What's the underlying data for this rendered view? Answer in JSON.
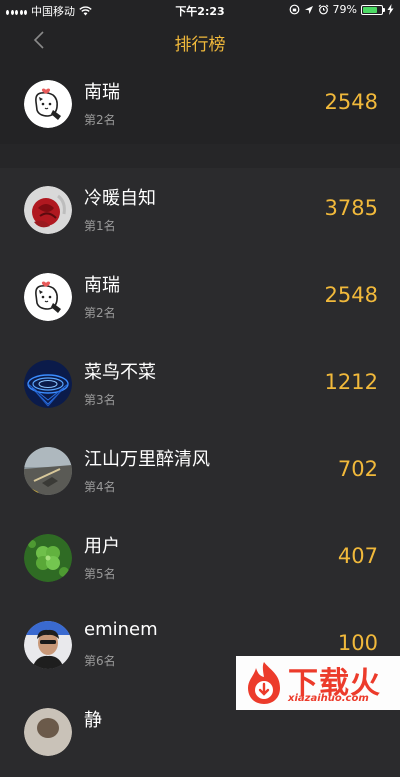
{
  "status": {
    "carrier": "中国移动",
    "time": "下午2:23",
    "battery": "79%",
    "battery_level": 0.79
  },
  "nav": {
    "title": "排行榜"
  },
  "my_rank": {
    "name": "南瑞",
    "rank_label": "第2名",
    "score": "2548"
  },
  "ranking": [
    {
      "name": "冷暖自知",
      "rank_label": "第1名",
      "score": "3785"
    },
    {
      "name": "南瑞",
      "rank_label": "第2名",
      "score": "2548"
    },
    {
      "name": "菜鸟不菜",
      "rank_label": "第3名",
      "score": "1212"
    },
    {
      "name": "江山万里醉清风",
      "rank_label": "第4名",
      "score": "702"
    },
    {
      "name": "用户",
      "rank_label": "第5名",
      "score": "407"
    },
    {
      "name": "eminem",
      "rank_label": "第6名",
      "score": "100"
    },
    {
      "name": "静",
      "rank_label": "",
      "score": ""
    }
  ],
  "watermark": {
    "brand": "下载火",
    "domain": "xiazaihuo.com"
  },
  "colors": {
    "accent": "#f1b93b",
    "background": "#2b2b2d",
    "header_background": "#232325"
  }
}
